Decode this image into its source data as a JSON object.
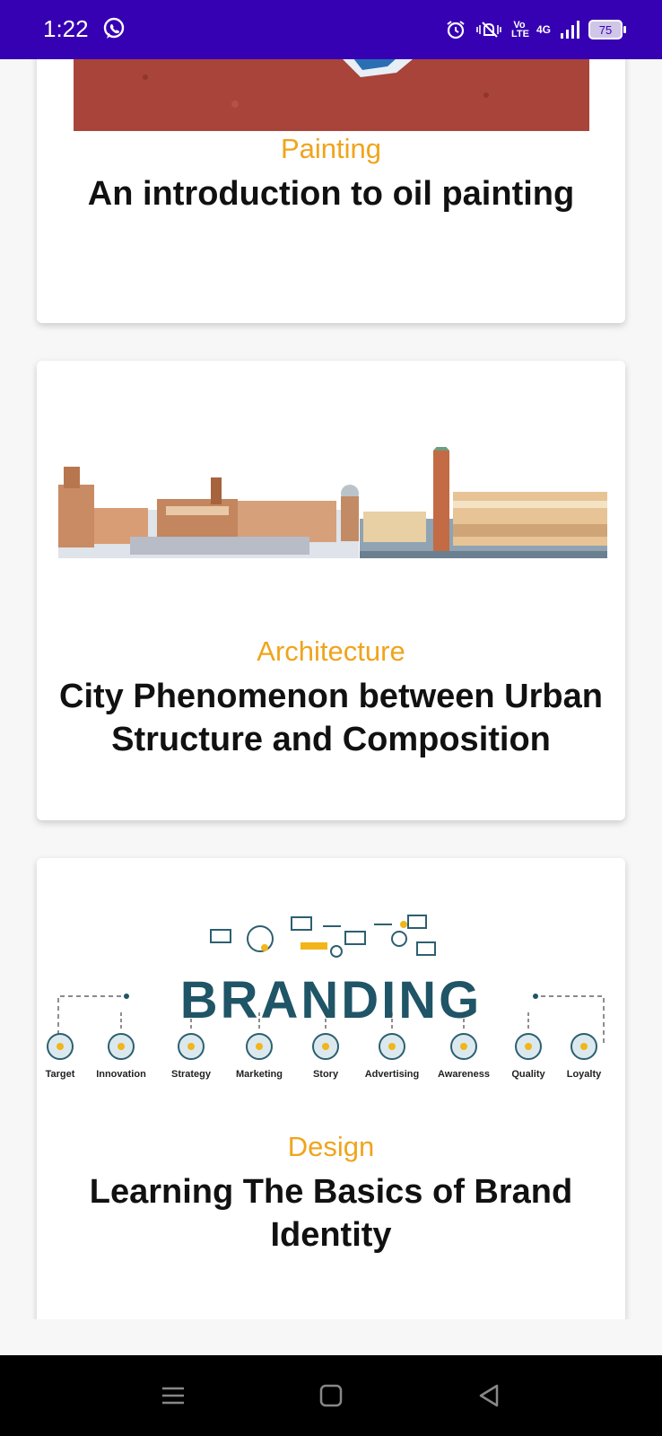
{
  "status_bar": {
    "time": "1:22",
    "network": "4G",
    "volte": "Vo LTE",
    "battery": "75"
  },
  "courses": [
    {
      "category": "Painting",
      "title": "An introduction to oil painting"
    },
    {
      "category": "Architecture",
      "title": "City Phenomenon between Urban Structure and Composition"
    },
    {
      "category": "Design",
      "title": "Learning The Basics of Brand Identity"
    }
  ],
  "branding_image": {
    "headline": "BRANDING",
    "labels": [
      "Target",
      "Innovation",
      "Strategy",
      "Marketing",
      "Story",
      "Advertising",
      "Awareness",
      "Quality",
      "Loyalty"
    ]
  },
  "colors": {
    "status_bar": "#3600b3",
    "category": "#f0a41c",
    "title": "#111111",
    "branding_text": "#1f5566"
  }
}
